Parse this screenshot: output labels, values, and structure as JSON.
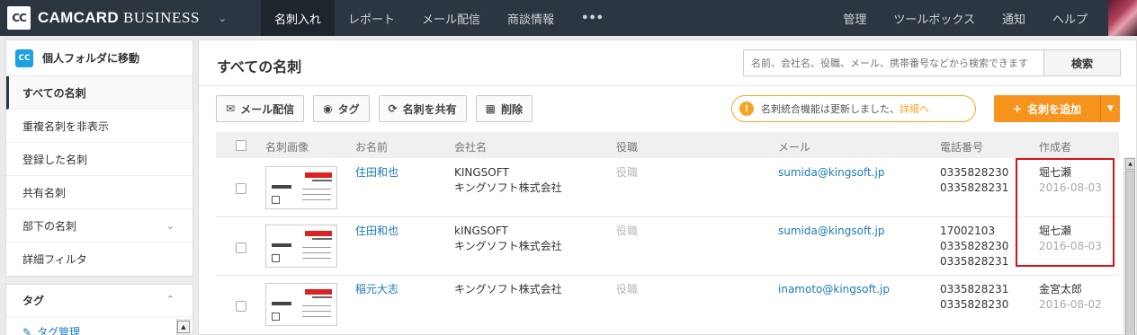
{
  "app": {
    "logo_mark": "CC",
    "brand_bold": "CAMCARD",
    "brand_thin": "BUSINESS",
    "nav": [
      "名刺入れ",
      "レポート",
      "メール配信",
      "商談情報",
      "•••"
    ],
    "nav_right": [
      "管理",
      "ツールボックス",
      "通知",
      "ヘルプ"
    ]
  },
  "sidebar": {
    "folder_link": "個人フォルダに移動",
    "items": [
      "すべての名刺",
      "重複名刺を非表示",
      "登録した名刺",
      "共有名刺",
      "部下の名刺",
      "詳細フィルタ"
    ],
    "tag_header": "タグ",
    "tag_manage": "タグ管理"
  },
  "main": {
    "title": "すべての名刺",
    "search_placeholder": "名前、会社名、役職、メール、携帯番号などから検索できます",
    "search_button": "検索",
    "toolbar": {
      "mail": "メール配信",
      "tag": "タグ",
      "share": "名刺を共有",
      "delete": "削除"
    },
    "notice_text": "名刺統合機能は更新しました、",
    "notice_link": "詳細へ",
    "add_button": "名刺を追加",
    "columns": {
      "image": "名刺画像",
      "name": "お名前",
      "company": "会社名",
      "role": "役職",
      "email": "メール",
      "phone": "電話番号",
      "creator": "作成者"
    },
    "rows": [
      {
        "name": "住田和也",
        "company_en": "KINGSOFT",
        "company_ja": "キングソフト株式会社",
        "role": "役職",
        "email": "sumida@kingsoft.jp",
        "phone1": "0335828230",
        "phone2": "0335828231",
        "phone3": "",
        "creator": "堀七瀬",
        "date": "2016-08-03"
      },
      {
        "name": "住田和也",
        "company_en": "kINGSOFT",
        "company_ja": "キングソフト株式会社",
        "role": "役職",
        "email": "sumida@kingsoft.jp",
        "phone1": "17002103",
        "phone2": "0335828230",
        "phone3": "0335828231",
        "creator": "堀七瀬",
        "date": "2016-08-03"
      },
      {
        "name": "稲元大志",
        "company_en": "",
        "company_ja": "キングソフト株式会社",
        "role": "役職",
        "email": "inamoto@kingsoft.jp",
        "phone1": "0335828231",
        "phone2": "0335828230",
        "phone3": "",
        "creator": "金宮太郎",
        "date": "2016-08-02"
      }
    ]
  }
}
